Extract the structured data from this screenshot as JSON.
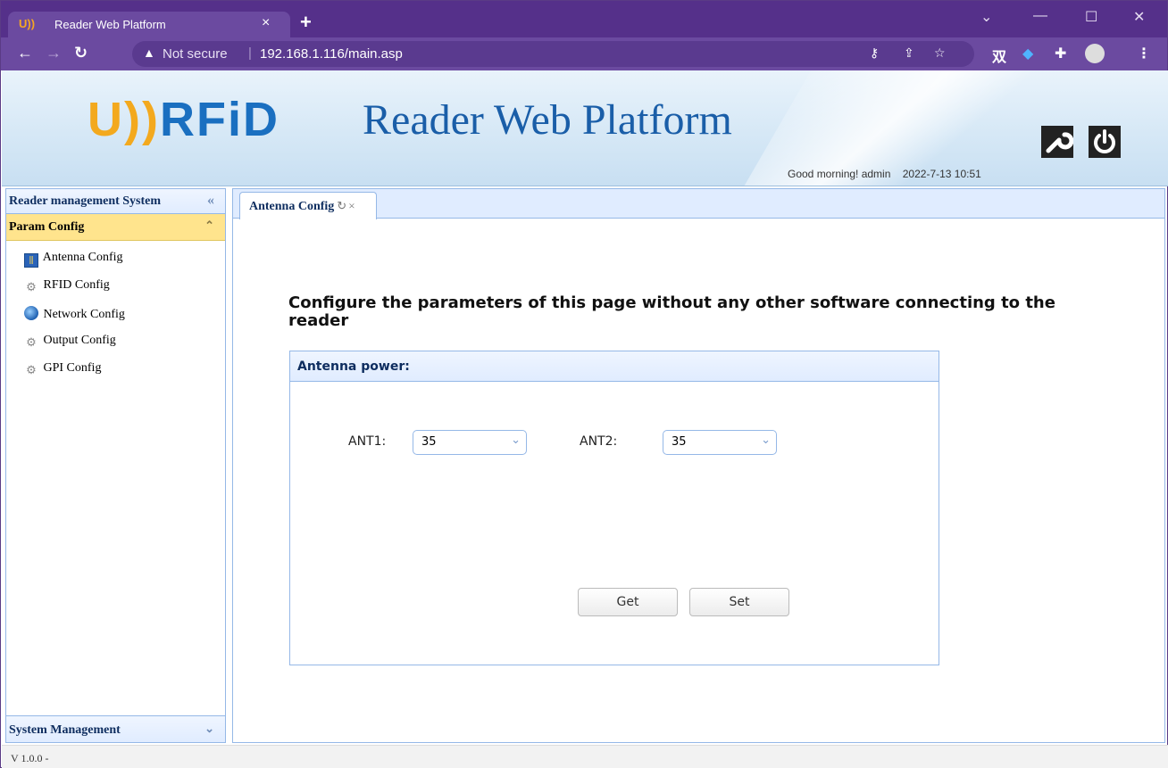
{
  "browser": {
    "tab_title": "Reader Web Platform",
    "tab_favicon": "U))",
    "tab_close": "×",
    "new_tab": "+",
    "not_secure": "Not secure",
    "url": "192.168.1.116/main.asp",
    "ext_label": "双"
  },
  "banner": {
    "logo_u": "U))",
    "logo_rfid": "RFiD",
    "title": "Reader Web Platform",
    "greeting": "Good morning! admin",
    "datetime": "2022-7-13 10:51"
  },
  "sidebar": {
    "title": "Reader management System",
    "group": "Param Config",
    "items": [
      {
        "label": "Antenna Config",
        "icon": "antenna-icon"
      },
      {
        "label": "RFID Config",
        "icon": "gear-icon"
      },
      {
        "label": "Network Config",
        "icon": "globe-icon"
      },
      {
        "label": "Output Config",
        "icon": "gear-icon"
      },
      {
        "label": "GPI Config",
        "icon": "gear-icon"
      }
    ],
    "footer_group": "System Management"
  },
  "content": {
    "tab_label": "Antenna Config",
    "headline": "Configure the parameters of this page without any other software connecting to the reader",
    "section_title": "Antenna power:",
    "ant1_label": "ANT1:",
    "ant1_value": "35",
    "ant2_label": "ANT2:",
    "ant2_value": "35",
    "get_label": "Get",
    "set_label": "Set"
  },
  "status": {
    "version": "V 1.0.0 -"
  },
  "colors": {
    "chrome": "#55308a",
    "panel_border": "#95b8e7",
    "active_group": "#ffe48d",
    "brand_blue": "#1a5ea8",
    "brand_orange": "#f3a91e"
  }
}
